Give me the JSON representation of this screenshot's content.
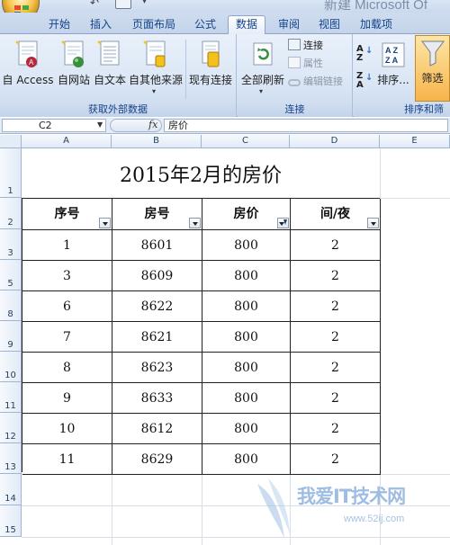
{
  "window": {
    "title": "新建 Microsoft Of"
  },
  "tabs": [
    {
      "label": "开始",
      "active": false
    },
    {
      "label": "插入",
      "active": false
    },
    {
      "label": "页面布局",
      "active": false
    },
    {
      "label": "公式",
      "active": false
    },
    {
      "label": "数据",
      "active": true
    },
    {
      "label": "审阅",
      "active": false
    },
    {
      "label": "视图",
      "active": false
    },
    {
      "label": "加载项",
      "active": false
    }
  ],
  "ribbon": {
    "groups": {
      "external": {
        "label": "获取外部数据",
        "buttons": [
          "自 Access",
          "自网站",
          "自文本",
          "自其他来源",
          "现有连接"
        ]
      },
      "connections": {
        "label": "连接",
        "refresh": "全部刷新",
        "small": [
          "连接",
          "属性",
          "编辑链接"
        ]
      },
      "sort_filter": {
        "label": "排序和筛",
        "sort": "排序...",
        "filter": "筛选"
      }
    }
  },
  "formula_bar": {
    "name_box": "C2",
    "fx": "fx",
    "content": "房价"
  },
  "columns": [
    "A",
    "B",
    "C",
    "D",
    "E"
  ],
  "rows": [
    "1",
    "2",
    "3",
    "5",
    "8",
    "9",
    "10",
    "11",
    "12",
    "13",
    "14",
    "15"
  ],
  "sheet": {
    "title": "2015年2月的房价",
    "headers": [
      "序号",
      "房号",
      "房价",
      "间/夜"
    ],
    "filtered_column": "房价",
    "data": [
      [
        "1",
        "8601",
        "800",
        "2"
      ],
      [
        "3",
        "8609",
        "800",
        "2"
      ],
      [
        "6",
        "8622",
        "800",
        "2"
      ],
      [
        "7",
        "8621",
        "800",
        "2"
      ],
      [
        "8",
        "8623",
        "800",
        "2"
      ],
      [
        "9",
        "8633",
        "800",
        "2"
      ],
      [
        "10",
        "8612",
        "800",
        "2"
      ],
      [
        "11",
        "8629",
        "800",
        "2"
      ]
    ]
  },
  "watermark": {
    "text": "我爱IT技术网",
    "url": "www.52ij.com"
  },
  "colors": {
    "ribbon_text": "#15428b",
    "filter_highlight": "#f7b44a",
    "header_blue": "#9eb6d4"
  }
}
